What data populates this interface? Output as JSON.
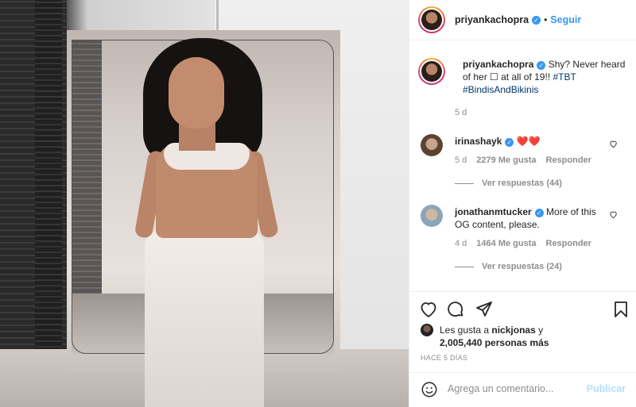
{
  "post": {
    "username": "priyankachopra",
    "follow_label": "Seguir",
    "separator": "•",
    "verified_mark": "✓"
  },
  "caption": {
    "username": "priyankachopra",
    "text": "Shy? Never heard of her ☐ at all of 19!!",
    "hashtags": [
      "#TBT",
      "#BindisAndBikinis"
    ],
    "time": "5 d"
  },
  "comments": [
    {
      "username": "irinashayk",
      "text": "❤️❤️",
      "time": "5 d",
      "likes": "2279 Me gusta",
      "reply_label": "Responder",
      "view_replies": "Ver respuestas (44)"
    },
    {
      "username": "jonathanmtucker",
      "text": "More of this OG content, please.",
      "time": "4 d",
      "likes": "1464 Me gusta",
      "reply_label": "Responder",
      "view_replies": "Ver respuestas (24)"
    }
  ],
  "likes_summary": {
    "prefix": "Les gusta a",
    "user": "nickjonas",
    "conj": "y",
    "others": "2,005,440 personas más"
  },
  "timestamp": "HACE 5 DÍAS",
  "comment_box": {
    "placeholder": "Agrega un comentario...",
    "publish_label": "Publicar"
  },
  "icons": {
    "like": "heart-icon",
    "comment": "comment-icon",
    "share": "share-icon",
    "save": "bookmark-icon",
    "emoji": "emoji-icon"
  },
  "colors": {
    "accent": "#3897f0",
    "heart": "#ed4956",
    "muted": "#8e8e8e"
  }
}
